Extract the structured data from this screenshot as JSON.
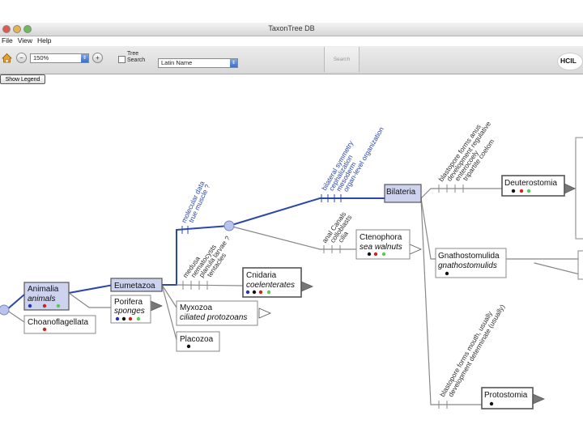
{
  "window": {
    "title": "TaxonTree DB"
  },
  "menu": {
    "file": "File",
    "view": "View",
    "help": "Help"
  },
  "toolbar": {
    "zoom_value": "150%",
    "zoom_out_symbol": "−",
    "zoom_in_symbol": "+",
    "scope_line1": "Tree",
    "scope_line2": "Search",
    "name_type": "Latin Name",
    "search_label": "Search",
    "logo": "HCIL"
  },
  "legend_button": "Show Legend",
  "dot_colors": {
    "black": "#111111",
    "red": "#cc2222",
    "blue": "#2233bb",
    "green": "#55cc55"
  },
  "nodes": {
    "animalia": {
      "latin": "Animalia",
      "common": "animals"
    },
    "choanoflagellata": {
      "latin": "Choanoflagellata"
    },
    "eumetazoa": {
      "latin": "Eumetazoa"
    },
    "porifera": {
      "latin": "Porifera",
      "common": "sponges"
    },
    "myxozoa": {
      "latin": "Myxozoa",
      "common": "ciliated protozoans"
    },
    "placozoa": {
      "latin": "Placozoa"
    },
    "cnidaria": {
      "latin": "Cnidaria",
      "common": "coelenterates"
    },
    "ctenophora": {
      "latin": "Ctenophora",
      "common": "sea walnuts"
    },
    "bilateria": {
      "latin": "Bilateria"
    },
    "deuterostomia": {
      "latin": "Deuterostomia"
    },
    "gnathostomulida": {
      "latin": "Gnathostomulida",
      "common": "gnathostomulids"
    },
    "protostomia": {
      "latin": "Protostomia"
    }
  },
  "traits": {
    "eumetazoa_branch": [
      "molecular data",
      "true muscle ?"
    ],
    "cnidaria_branch": [
      "medusa",
      "nematocysts",
      "planula larvae ?",
      "tentacles"
    ],
    "ctenophora_branch": [
      "anal Canals",
      "colloblasts",
      "cilia"
    ],
    "bilateria_branch": [
      "bilateral symmetry",
      "cephalization",
      "mesoderm",
      "organ-level organization"
    ],
    "deuterostomia_branch": [
      "blastopore forms anus",
      "development regulative",
      "enterocoely",
      "tripartite coelom"
    ],
    "protostomia_branch": [
      "blastopore forms mouth, usually",
      "development determinate (usually)"
    ]
  }
}
